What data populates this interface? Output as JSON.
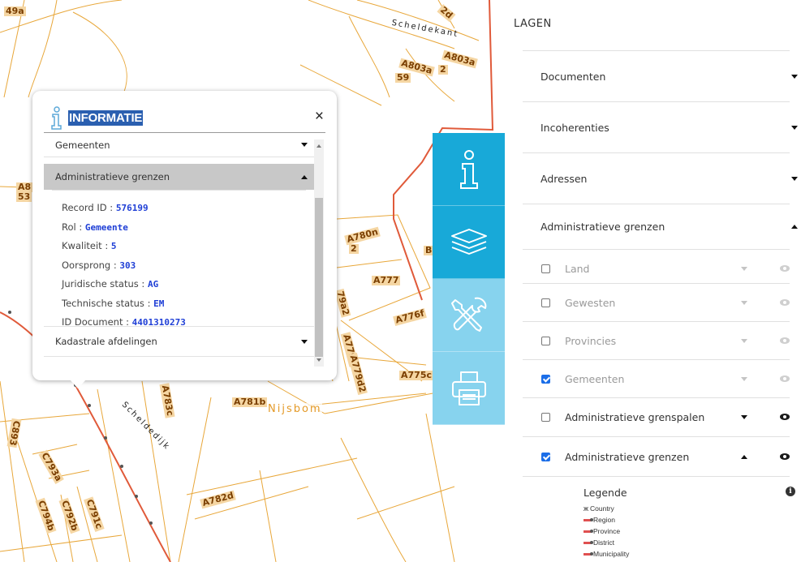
{
  "map": {
    "parcels": [
      "49a",
      "2d",
      "A803a",
      "2",
      "A803a",
      "59",
      "A8",
      "53",
      "A780n",
      "2",
      "B",
      "A777",
      "79a2",
      "A776f",
      "A779z",
      "A779d2",
      "A775c",
      "A781b",
      "A783c",
      "C893",
      "C793a",
      "C794b",
      "C792b",
      "C791c",
      "A782d"
    ],
    "streets": [
      "Scheldekant",
      "Scheldedijk"
    ],
    "place": "Nijsbom"
  },
  "popup": {
    "title": "INFORMATIE",
    "close": "×",
    "sections": {
      "gemeenten": "Gemeenten",
      "admin": "Administratieve grenzen",
      "kadastrale": "Kadastrale afdelingen"
    },
    "attributes": [
      {
        "label": "Record ID : ",
        "value": "576199"
      },
      {
        "label": "Rol : ",
        "value": "Gemeente"
      },
      {
        "label": "Kwaliteit : ",
        "value": "5"
      },
      {
        "label": "Oorsprong : ",
        "value": "303"
      },
      {
        "label": "Juridische status : ",
        "value": "AG"
      },
      {
        "label": "Technische status : ",
        "value": "EM"
      },
      {
        "label": "ID Document : ",
        "value": "4401310273"
      }
    ]
  },
  "toolbar": {
    "icons": [
      "info-icon",
      "layers-icon",
      "tools-icon",
      "print-icon"
    ],
    "colors": {
      "active": "#18a9d8",
      "inactive": "#87d3ee"
    }
  },
  "panel": {
    "title": "LAGEN",
    "groups": [
      "Documenten",
      "Incoherenties",
      "Adressen",
      "Administratieve grenzen"
    ],
    "layers": [
      {
        "name": "Land",
        "checked": false
      },
      {
        "name": "Gewesten",
        "checked": false
      },
      {
        "name": "Provincies",
        "checked": false
      },
      {
        "name": "Gemeenten",
        "checked": true
      },
      {
        "name": "Administratieve grenspalen",
        "checked": false
      },
      {
        "name": "Administratieve grenzen",
        "checked": true
      }
    ],
    "legend": {
      "title": "Legende",
      "items": [
        "Country",
        "Region",
        "Province",
        "District",
        "Municipality"
      ]
    }
  }
}
